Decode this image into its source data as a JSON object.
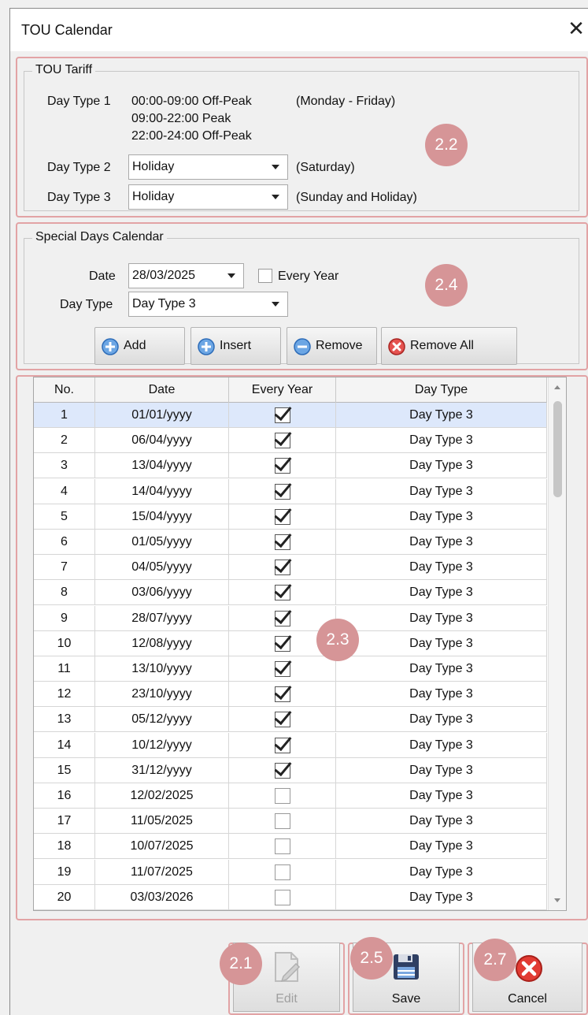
{
  "window": {
    "title": "TOU Calendar"
  },
  "tariff": {
    "group_title": "TOU Tariff",
    "day_type_1_label": "Day Type 1",
    "periods": [
      "00:00-09:00 Off-Peak",
      "09:00-22:00 Peak",
      "22:00-24:00 Off-Peak"
    ],
    "day_type_1_note": "(Monday - Friday)",
    "day_type_2_label": "Day Type 2",
    "day_type_2_value": "Holiday",
    "day_type_2_note": "(Saturday)",
    "day_type_3_label": "Day Type 3",
    "day_type_3_value": "Holiday",
    "day_type_3_note": "(Sunday and Holiday)"
  },
  "special": {
    "group_title": "Special Days Calendar",
    "date_label": "Date",
    "date_value": "28/03/2025",
    "every_year_label": "Every Year",
    "every_year_checked": false,
    "day_type_label": "Day Type",
    "day_type_value": "Day Type 3",
    "buttons": {
      "add": "Add",
      "insert": "Insert",
      "remove": "Remove",
      "remove_all": "Remove All"
    }
  },
  "grid": {
    "columns": [
      "No.",
      "Date",
      "Every Year",
      "Day Type"
    ],
    "rows": [
      {
        "no": "1",
        "date": "01/01/yyyy",
        "every_year": true,
        "day_type": "Day Type 3"
      },
      {
        "no": "2",
        "date": "06/04/yyyy",
        "every_year": true,
        "day_type": "Day Type 3"
      },
      {
        "no": "3",
        "date": "13/04/yyyy",
        "every_year": true,
        "day_type": "Day Type 3"
      },
      {
        "no": "4",
        "date": "14/04/yyyy",
        "every_year": true,
        "day_type": "Day Type 3"
      },
      {
        "no": "5",
        "date": "15/04/yyyy",
        "every_year": true,
        "day_type": "Day Type 3"
      },
      {
        "no": "6",
        "date": "01/05/yyyy",
        "every_year": true,
        "day_type": "Day Type 3"
      },
      {
        "no": "7",
        "date": "04/05/yyyy",
        "every_year": true,
        "day_type": "Day Type 3"
      },
      {
        "no": "8",
        "date": "03/06/yyyy",
        "every_year": true,
        "day_type": "Day Type 3"
      },
      {
        "no": "9",
        "date": "28/07/yyyy",
        "every_year": true,
        "day_type": "Day Type 3"
      },
      {
        "no": "10",
        "date": "12/08/yyyy",
        "every_year": true,
        "day_type": "Day Type 3"
      },
      {
        "no": "11",
        "date": "13/10/yyyy",
        "every_year": true,
        "day_type": "Day Type 3"
      },
      {
        "no": "12",
        "date": "23/10/yyyy",
        "every_year": true,
        "day_type": "Day Type 3"
      },
      {
        "no": "13",
        "date": "05/12/yyyy",
        "every_year": true,
        "day_type": "Day Type 3"
      },
      {
        "no": "14",
        "date": "10/12/yyyy",
        "every_year": true,
        "day_type": "Day Type 3"
      },
      {
        "no": "15",
        "date": "31/12/yyyy",
        "every_year": true,
        "day_type": "Day Type 3"
      },
      {
        "no": "16",
        "date": "12/02/2025",
        "every_year": false,
        "day_type": "Day Type 3"
      },
      {
        "no": "17",
        "date": "11/05/2025",
        "every_year": false,
        "day_type": "Day Type 3"
      },
      {
        "no": "18",
        "date": "10/07/2025",
        "every_year": false,
        "day_type": "Day Type 3"
      },
      {
        "no": "19",
        "date": "11/07/2025",
        "every_year": false,
        "day_type": "Day Type 3"
      },
      {
        "no": "20",
        "date": "03/03/2026",
        "every_year": false,
        "day_type": "Day Type 3"
      }
    ]
  },
  "footer": {
    "edit": "Edit",
    "save": "Save",
    "cancel": "Cancel"
  },
  "callouts": [
    "2.1",
    "2.2",
    "2.3",
    "2.4",
    "2.5",
    "2.7"
  ],
  "colors": {
    "callout": "#d69597",
    "selected_row": "#dde8fb"
  }
}
